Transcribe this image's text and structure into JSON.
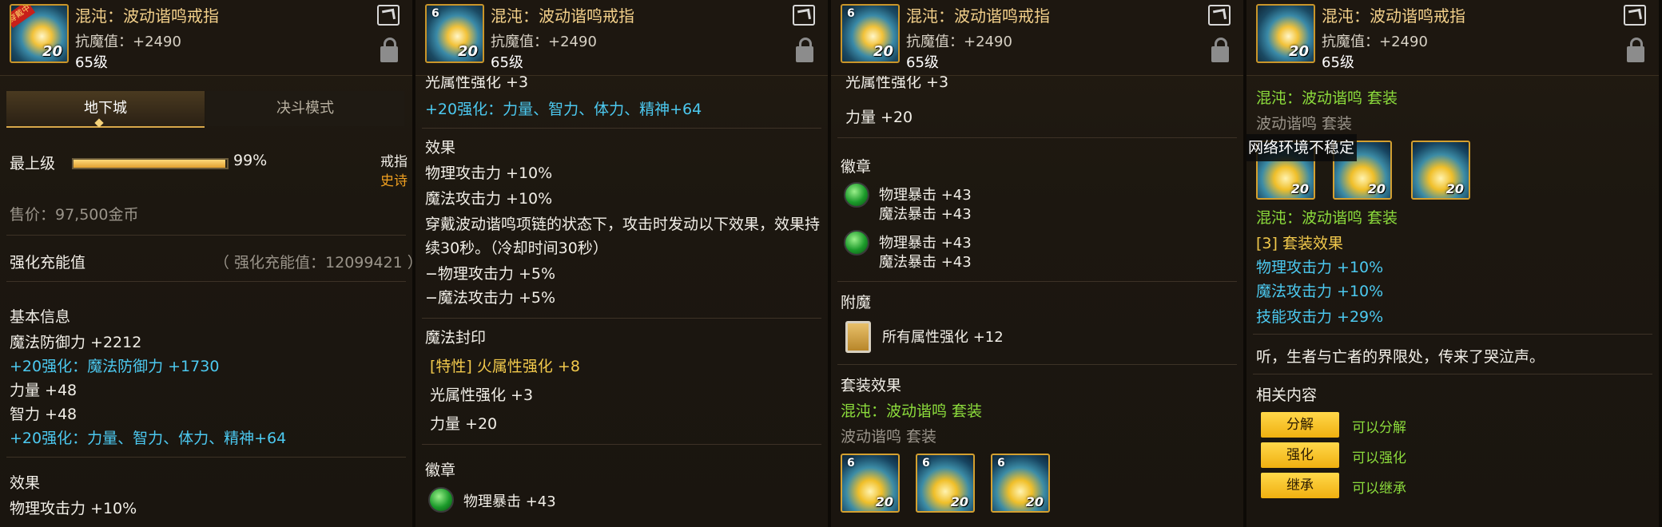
{
  "item": {
    "name": "混沌：波动谐鸣戒指",
    "anti_magic": "抗魔值：+2490",
    "level": "65级",
    "icon_level": "20",
    "icon_top_level": "6",
    "icon_badge": "穿戴中"
  },
  "panel1": {
    "tabs": [
      "地下城",
      "决斗模式"
    ],
    "grade": "最上级",
    "grade_percent_value": 99,
    "grade_percent": "99%",
    "slot": "戒指",
    "rarity": "史诗",
    "price": "售价：97,500金币",
    "enhance_title": "强化充能值",
    "enhance_value": "（ 强化充能值：12099421 ）",
    "basic_title": "基本信息",
    "magic_def": "魔法防御力 +2212",
    "magic_def_bonus": "+20强化：魔法防御力 +1730",
    "str": "力量 +48",
    "int": "智力 +48",
    "stat_bonus": "+20强化：力量、智力、体力、精神+64",
    "effect_title": "效果",
    "effect_cut": "物理攻击力 +10%"
  },
  "panel2": {
    "cut_top": "光属性强化 +3",
    "stat_bonus": "+20强化：力量、智力、体力、精神+64",
    "effect_title": "效果",
    "effects": [
      "物理攻击力 +10%",
      "魔法攻击力 +10%",
      "穿戴波动谐鸣项链的状态下，攻击时发动以下效果，效果持",
      "续30秒。（冷却时间30秒）",
      "−物理攻击力 +5%",
      "−魔法攻击力 +5%"
    ],
    "seal_title": "魔法封印",
    "seal_special": "[特性] 火属性强化 +8",
    "seal_light": "光属性强化 +3",
    "seal_str": "力量 +20",
    "emblem_title": "徽章",
    "emblem_1": "物理暴击 +43"
  },
  "panel3": {
    "cut_top": "光属性强化 +3",
    "str": "力量 +20",
    "emblem_title": "徽章",
    "emblems": [
      [
        "物理暴击 +43",
        "魔法暴击 +43"
      ],
      [
        "物理暴击 +43",
        "魔法暴击 +43"
      ]
    ],
    "enchant_title": "附魔",
    "enchant": "所有属性强化 +12",
    "set_title": "套装效果",
    "set_name": "混沌：波动谐鸣 套装",
    "set_sub": "波动谐鸣 套装"
  },
  "panel4": {
    "set_name": "混沌：波动谐鸣 套装",
    "set_sub": "波动谐鸣 套装",
    "toast": "网络环境不稳定",
    "set_name2": "混沌：波动谐鸣 套装",
    "set_effect_title": "[3] 套装效果",
    "set_effects": [
      "物理攻击力 +10%",
      "魔法攻击力 +10%",
      "技能攻击力 +29%"
    ],
    "flavor": "听，生者与亡者的界限处，传来了哭泣声。",
    "related_title": "相关内容",
    "buttons": [
      {
        "label": "分解",
        "note": "可以分解"
      },
      {
        "label": "强化",
        "note": "可以强化"
      },
      {
        "label": "继承",
        "note": "可以继承"
      }
    ]
  }
}
